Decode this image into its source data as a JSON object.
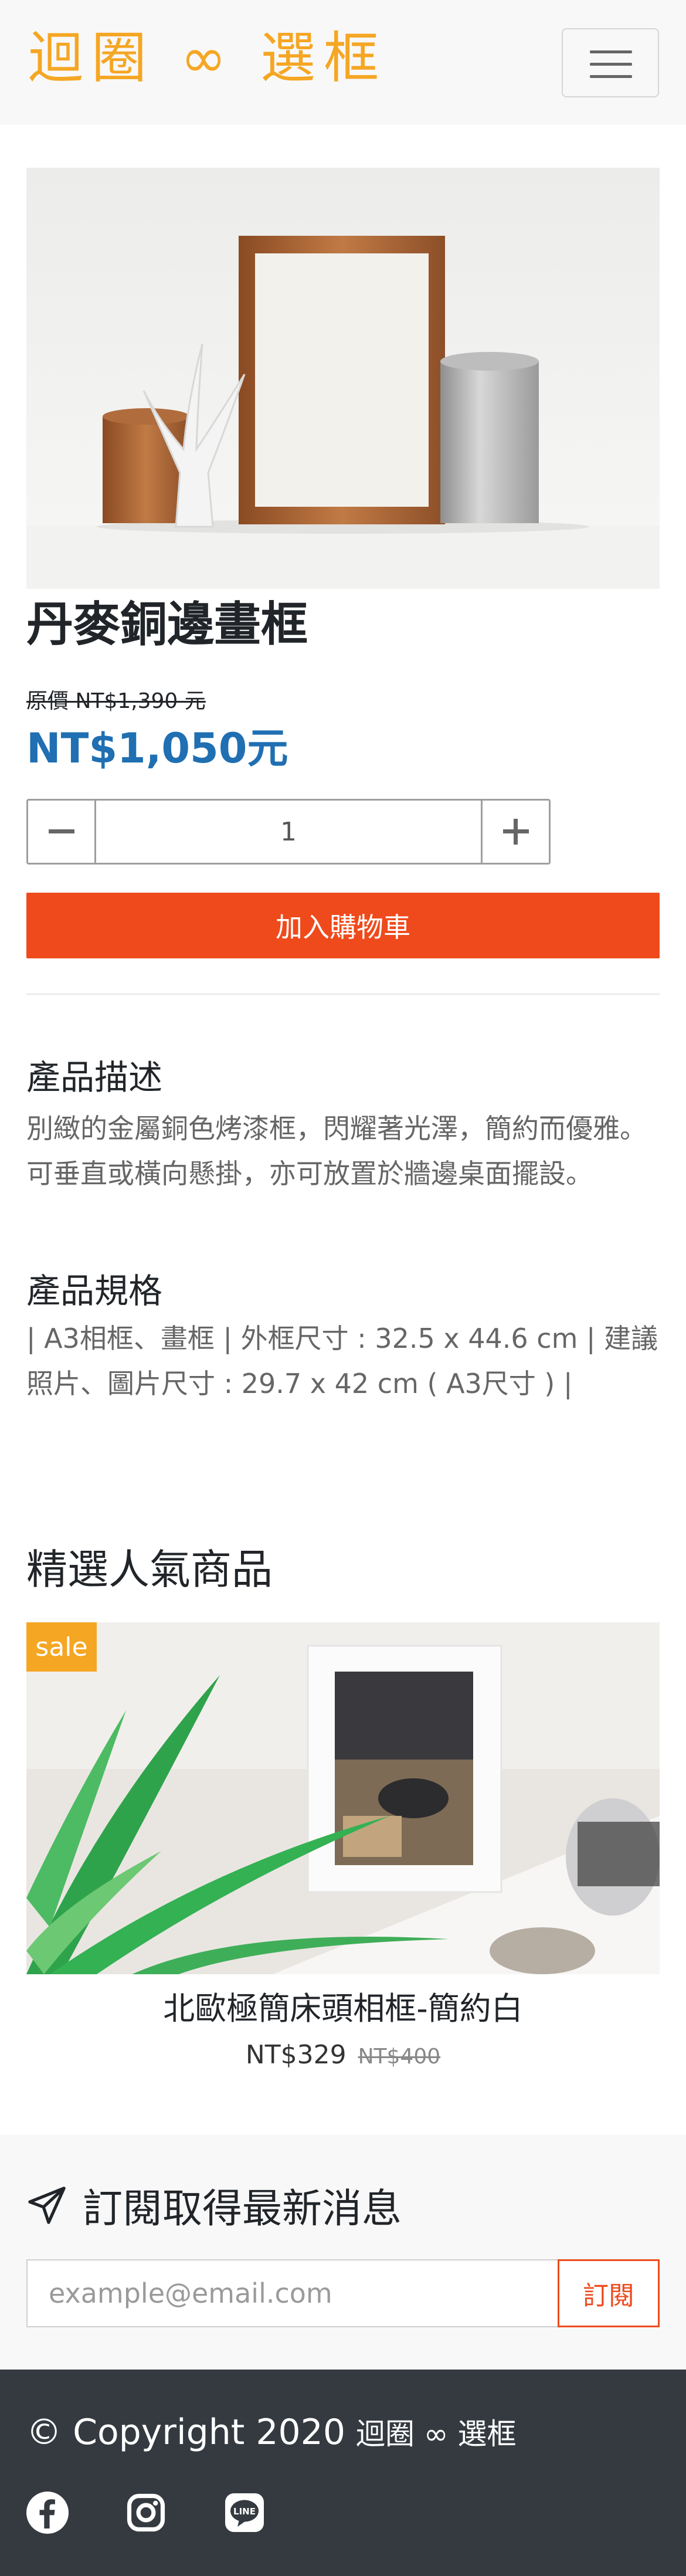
{
  "brand": {
    "name": "迴圈 ∞ 選框"
  },
  "nav": {
    "toggle_icon": "hamburger-icon"
  },
  "product": {
    "title": "丹麥銅邊畫框",
    "original_price": "原價 NT$1,390 元",
    "sale_price": "NT$1,050元",
    "quantity": "1",
    "add_to_cart": "加入購物車"
  },
  "description": {
    "title": "產品描述",
    "body": "別緻的金屬銅色烤漆框，閃耀著光澤，簡約而優雅。 可垂直或橫向懸掛，亦可放置於牆邊桌面擺設。"
  },
  "specs": {
    "title": "產品規格",
    "body": "| A3相框、畫框 | 外框尺寸 : 32.5 x 44.6 cm | 建議照片、圖片尺寸 : 29.7 x 42 cm ( A3尺寸 ) |"
  },
  "popular": {
    "title": "精選人氣商品",
    "card": {
      "badge": "sale",
      "name": "北歐極簡床頭相框-簡約白",
      "price": "NT$329",
      "original_price": "NT$400"
    }
  },
  "subscribe": {
    "icon": "paper-plane-icon",
    "title": "訂閱取得最新消息",
    "placeholder": "example@email.com",
    "button": "訂閱"
  },
  "footer": {
    "copyright": "© Copyright 2020",
    "brand": "迴圈 ∞ 選框",
    "social": [
      "facebook-icon",
      "instagram-icon",
      "line-icon"
    ]
  },
  "colors": {
    "brand": "#f5a623",
    "accent": "#ef4a1c",
    "price": "#1f6fb2",
    "footer": "#343a40"
  }
}
